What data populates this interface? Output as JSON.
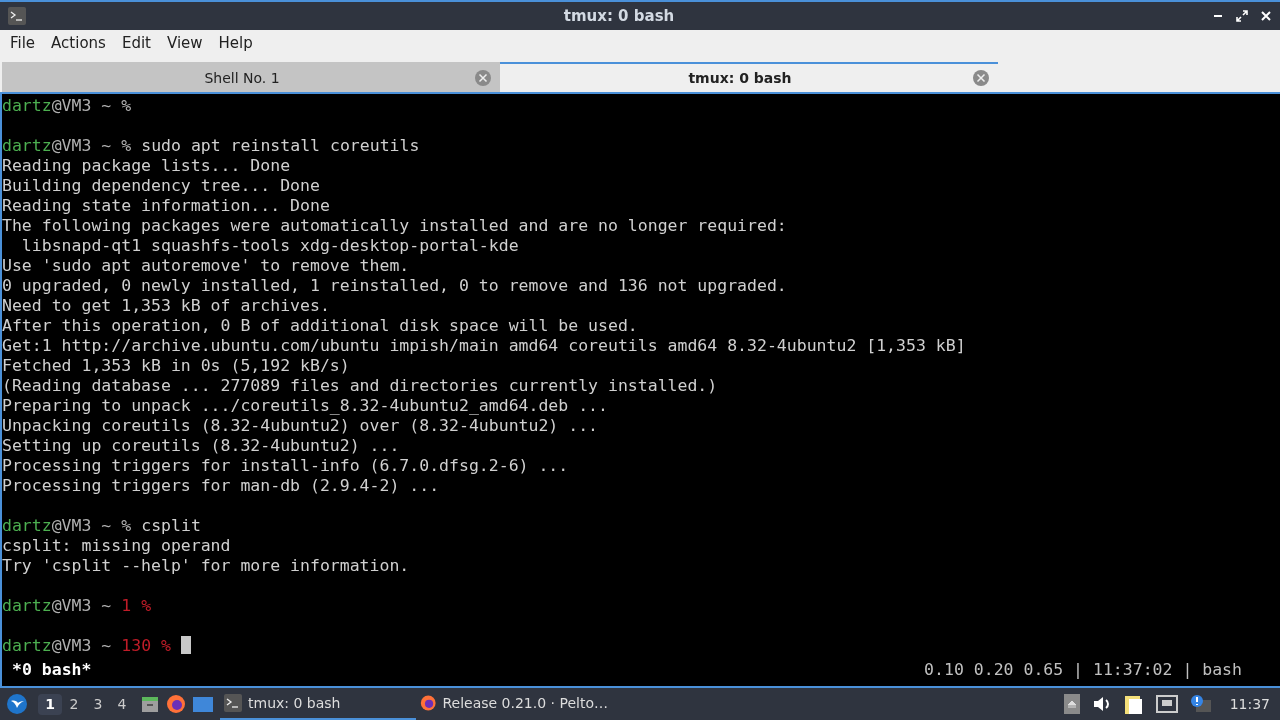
{
  "window": {
    "title": "tmux: 0 bash"
  },
  "menu": [
    "File",
    "Actions",
    "Edit",
    "View",
    "Help"
  ],
  "tabs": [
    {
      "label": "Shell No. 1",
      "selected": false
    },
    {
      "label": "tmux: 0 bash",
      "selected": true
    }
  ],
  "terminal": {
    "lines": [
      {
        "kind": "prompt",
        "user": "dartz",
        "host": "@VM3 ~",
        "symbol": "%"
      },
      {
        "kind": "blank"
      },
      {
        "kind": "prompt",
        "user": "dartz",
        "host": "@VM3 ~",
        "symbol": "%",
        "command": "sudo apt reinstall coreutils"
      },
      {
        "kind": "output",
        "text": "Reading package lists... Done"
      },
      {
        "kind": "output",
        "text": "Building dependency tree... Done"
      },
      {
        "kind": "output",
        "text": "Reading state information... Done"
      },
      {
        "kind": "output",
        "text": "The following packages were automatically installed and are no longer required:"
      },
      {
        "kind": "output",
        "text": "  libsnapd-qt1 squashfs-tools xdg-desktop-portal-kde"
      },
      {
        "kind": "output",
        "text": "Use 'sudo apt autoremove' to remove them."
      },
      {
        "kind": "output",
        "text": "0 upgraded, 0 newly installed, 1 reinstalled, 0 to remove and 136 not upgraded."
      },
      {
        "kind": "output",
        "text": "Need to get 1,353 kB of archives."
      },
      {
        "kind": "output",
        "text": "After this operation, 0 B of additional disk space will be used."
      },
      {
        "kind": "output",
        "text": "Get:1 http://archive.ubuntu.com/ubuntu impish/main amd64 coreutils amd64 8.32-4ubuntu2 [1,353 kB]"
      },
      {
        "kind": "output",
        "text": "Fetched 1,353 kB in 0s (5,192 kB/s)"
      },
      {
        "kind": "output",
        "text": "(Reading database ... 277089 files and directories currently installed.)"
      },
      {
        "kind": "output",
        "text": "Preparing to unpack .../coreutils_8.32-4ubuntu2_amd64.deb ..."
      },
      {
        "kind": "output",
        "text": "Unpacking coreutils (8.32-4ubuntu2) over (8.32-4ubuntu2) ..."
      },
      {
        "kind": "output",
        "text": "Setting up coreutils (8.32-4ubuntu2) ..."
      },
      {
        "kind": "output",
        "text": "Processing triggers for install-info (6.7.0.dfsg.2-6) ..."
      },
      {
        "kind": "output",
        "text": "Processing triggers for man-db (2.9.4-2) ..."
      },
      {
        "kind": "blank"
      },
      {
        "kind": "prompt",
        "user": "dartz",
        "host": "@VM3 ~",
        "symbol": "%",
        "command": "csplit"
      },
      {
        "kind": "output",
        "text": "csplit: missing operand"
      },
      {
        "kind": "output",
        "text": "Try 'csplit --help' for more information."
      },
      {
        "kind": "blank"
      },
      {
        "kind": "prompt",
        "user": "dartz",
        "host": "@VM3 ~",
        "status": "1",
        "symbol": "%"
      },
      {
        "kind": "blank"
      },
      {
        "kind": "prompt",
        "user": "dartz",
        "host": "@VM3 ~",
        "status": "130",
        "symbol": "%",
        "cursor": true
      }
    ],
    "status_left": "*0 bash*",
    "status_right": "0.10 0.20 0.65 | 11:37:02 | bash"
  },
  "taskbar": {
    "desktops": [
      {
        "label": "1",
        "selected": true
      },
      {
        "label": "2",
        "selected": false
      },
      {
        "label": "3",
        "selected": false
      },
      {
        "label": "4",
        "selected": false
      }
    ],
    "tasks": [
      {
        "kind": "terminal",
        "label": "tmux: 0 bash",
        "selected": true
      },
      {
        "kind": "browser",
        "label": "Release 0.21.0 · Pelto…",
        "selected": false
      }
    ],
    "clock": "11:37"
  }
}
